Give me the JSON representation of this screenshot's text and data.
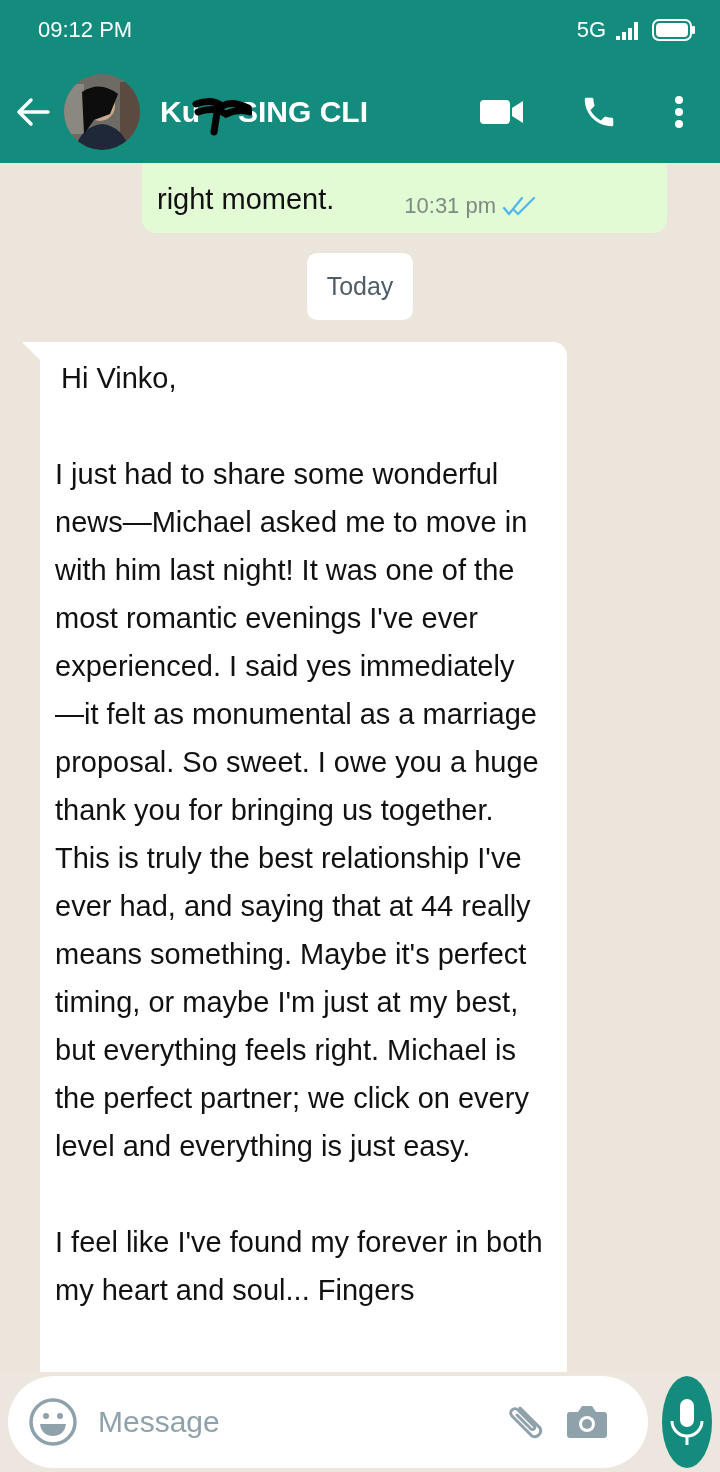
{
  "status_bar": {
    "time": "09:12 PM",
    "network": "5G"
  },
  "header": {
    "name_start": "Ku",
    "name_end": "SING CLI",
    "name_redacted": true
  },
  "messages": [
    {
      "kind": "outgoing",
      "paragraphs": [
        "right moment."
      ],
      "time": "10:31 pm",
      "read": true
    },
    {
      "kind": "date",
      "paragraphs": [
        "Today"
      ]
    },
    {
      "kind": "incoming",
      "paragraphs": [
        "Hi Vinko,",
        "I just had to share some wonderful news—Michael asked me to move in with him last night! It was one of the most romantic evenings I've ever experienced. I said yes immediately —it felt as monumental as a marriage proposal. So sweet. I owe you a huge thank you for bringing us together. This is truly the best relationship I've ever had, and saying that at 44 really means something. Maybe it's perfect timing, or maybe I'm just at my best, but everything feels right. Michael is the perfect partner; we click on every level and everything is just easy.",
        "I feel like I've found my forever in both my heart and soul... Fingers"
      ]
    }
  ],
  "composer": {
    "placeholder": "Message"
  }
}
